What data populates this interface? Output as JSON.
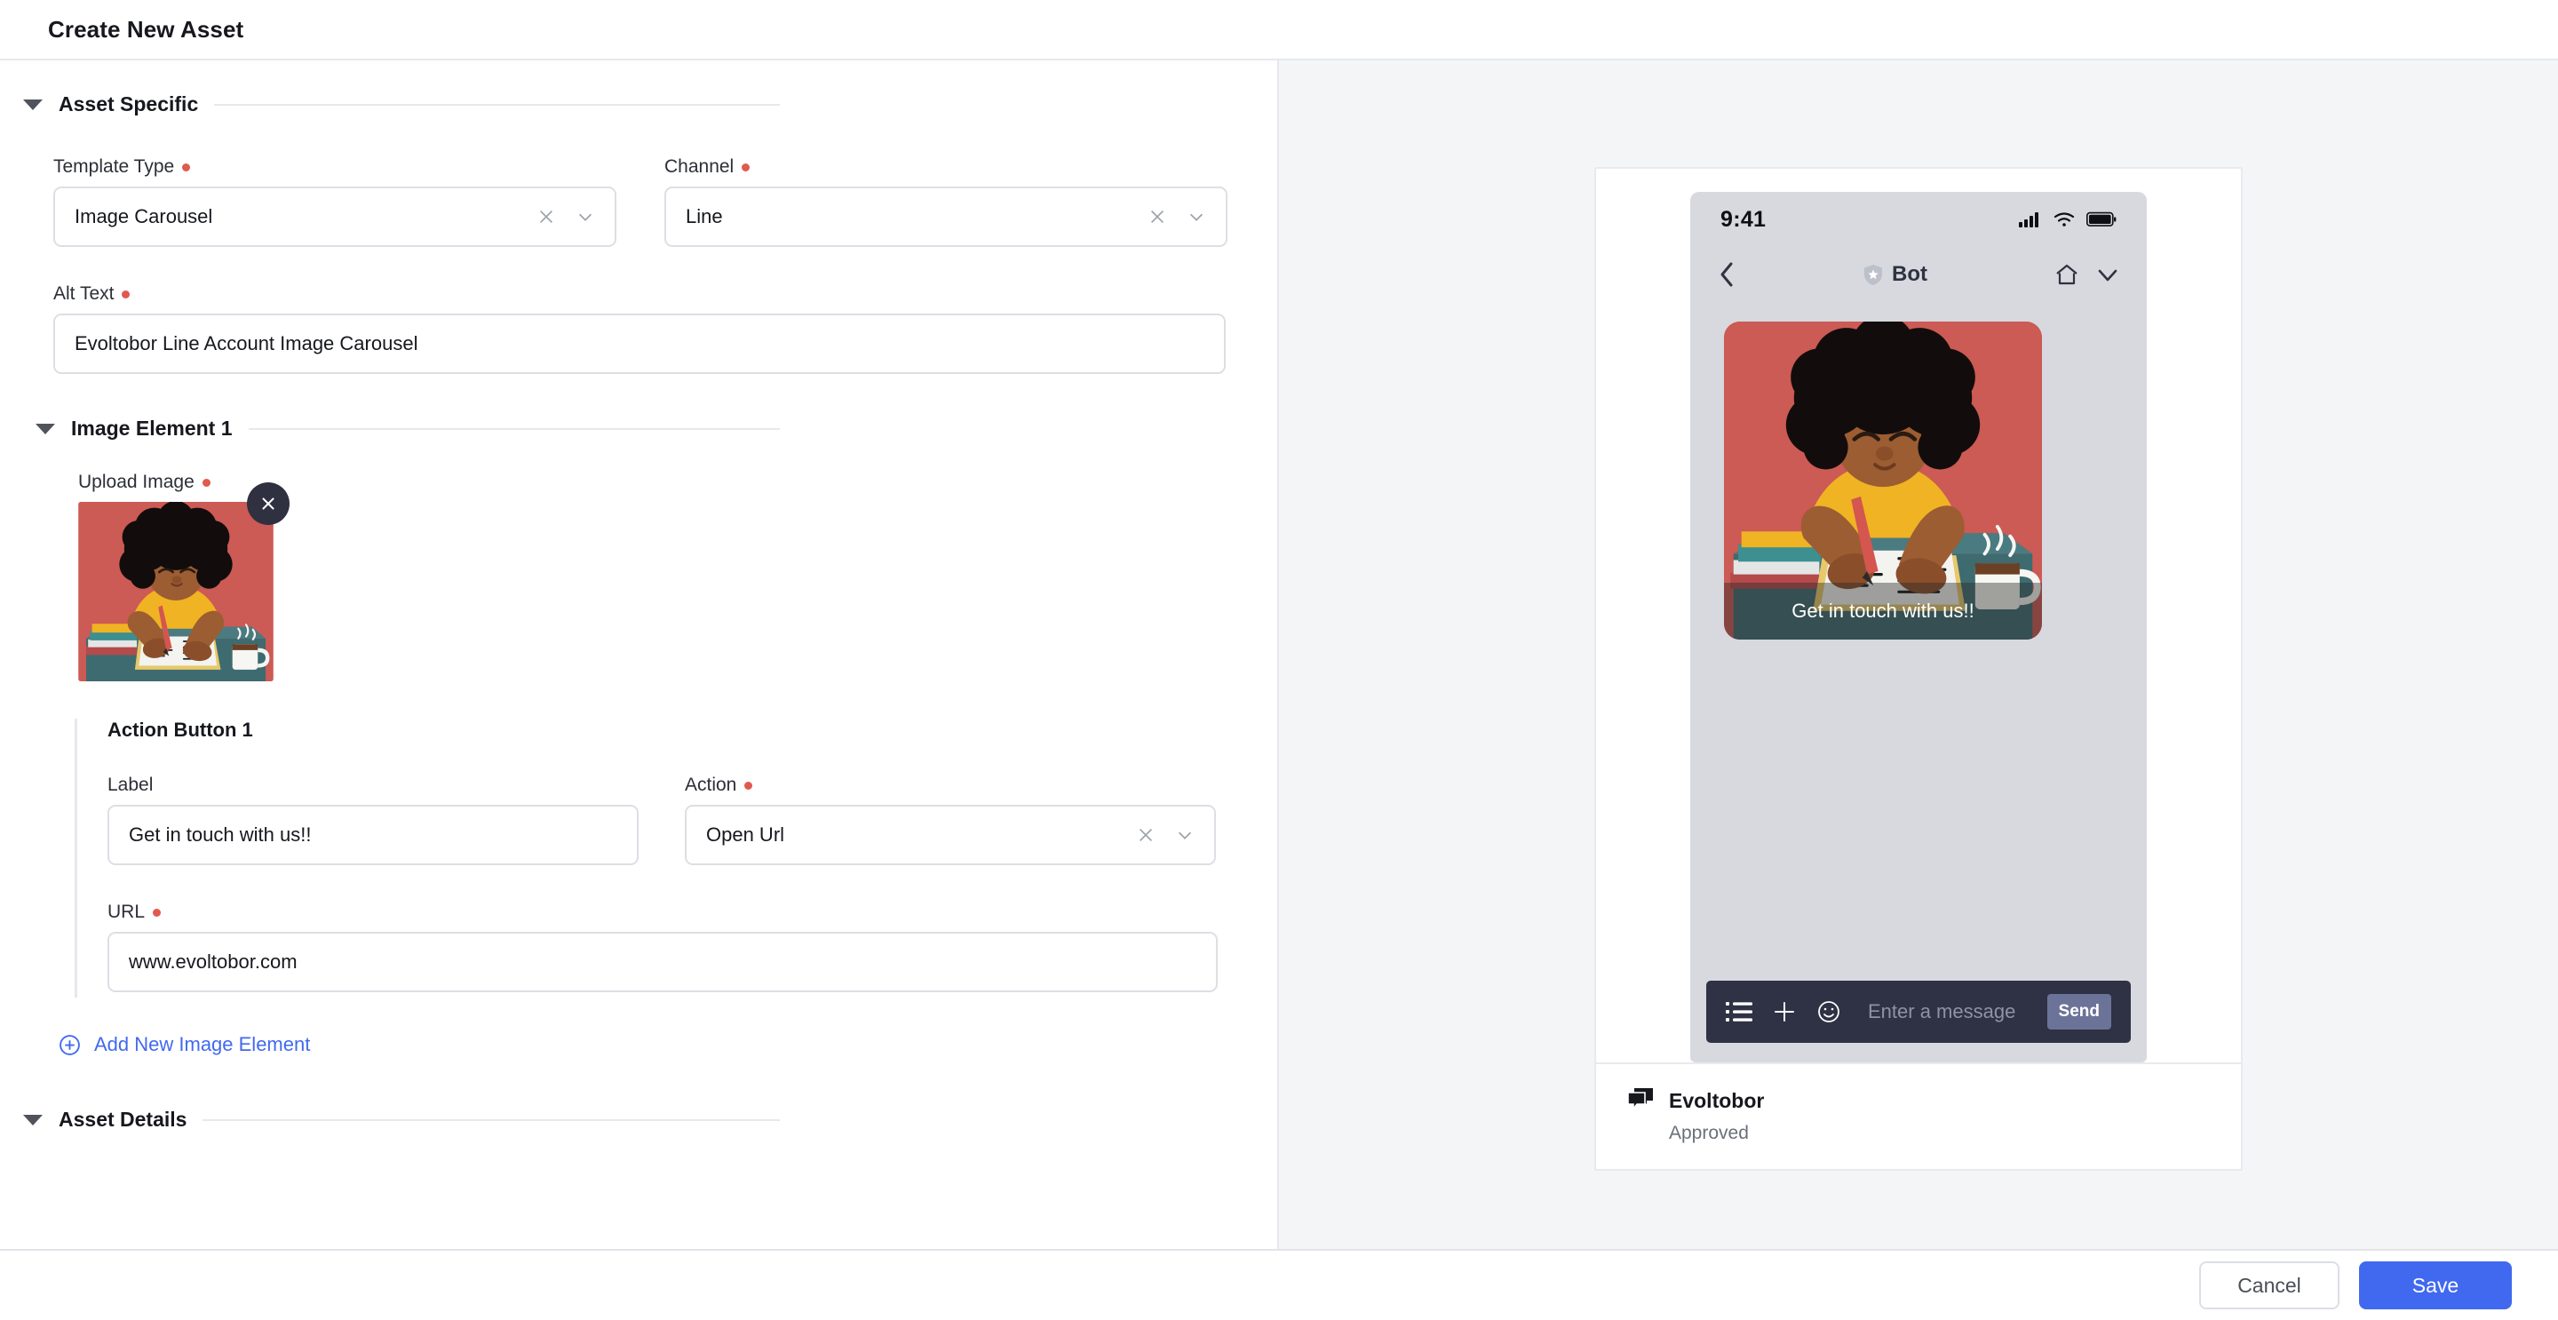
{
  "window": {
    "title": "Create New Asset"
  },
  "sections": {
    "asset_specific": "Asset Specific",
    "image_element_1": "Image Element 1",
    "asset_details": "Asset Details"
  },
  "fields": {
    "template_type": {
      "label": "Template Type",
      "value": "Image Carousel",
      "required": true
    },
    "channel": {
      "label": "Channel",
      "value": "Line",
      "required": true
    },
    "alt_text": {
      "label": "Alt Text",
      "value": "Evoltobor Line Account Image Carousel",
      "required": true
    },
    "upload_image": {
      "label": "Upload Image",
      "required": true
    }
  },
  "action_button": {
    "title": "Action Button 1",
    "label_field": {
      "label": "Label",
      "value": "Get in touch with us!!",
      "required": false
    },
    "action_field": {
      "label": "Action",
      "value": "Open Url",
      "required": true
    },
    "url_field": {
      "label": "URL",
      "value": "www.evoltobor.com",
      "required": true
    }
  },
  "add_link": {
    "label": "Add New Image Element"
  },
  "preview": {
    "phone": {
      "status_time": "9:41",
      "header_title": "Bot",
      "bubble_button_label": "Get in touch with us!!",
      "message_placeholder": "Enter a message",
      "send_label": "Send"
    },
    "footer": {
      "name": "Evoltobor",
      "status": "Approved"
    }
  },
  "footer_actions": {
    "cancel": "Cancel",
    "save": "Save"
  },
  "colors": {
    "accent_blue": "#4169f0",
    "required_dot": "#e05a4e",
    "illustration_bg": "#cc5a55",
    "shirt_yellow": "#f0b323",
    "desk_teal": "#3e6b70",
    "panel_bg": "#f4f5f7"
  }
}
